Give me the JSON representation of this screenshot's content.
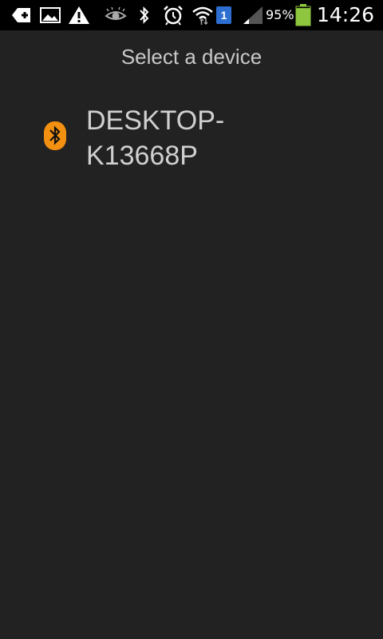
{
  "status_bar": {
    "icons": {
      "left": [
        "message-add-icon",
        "gallery-icon",
        "warning-icon"
      ],
      "right": [
        "eye-icon",
        "bluetooth-icon",
        "alarm-icon",
        "wifi-icon",
        "sim-icon",
        "signal-icon",
        "battery-icon"
      ]
    },
    "sim_number": "1",
    "battery_percent": "95%",
    "battery_level": 0.95,
    "time": "14:26"
  },
  "dialog": {
    "title": "Select a device"
  },
  "devices": [
    {
      "name_line1": "DESKTOP-",
      "name_line2": "K13668P",
      "icon": "bluetooth-icon"
    }
  ],
  "colors": {
    "background": "#222222",
    "status_bar": "#000000",
    "bluetooth_accent": "#f39011",
    "battery_fill": "#8ec63f",
    "sim_badge": "#2d6fd0"
  }
}
